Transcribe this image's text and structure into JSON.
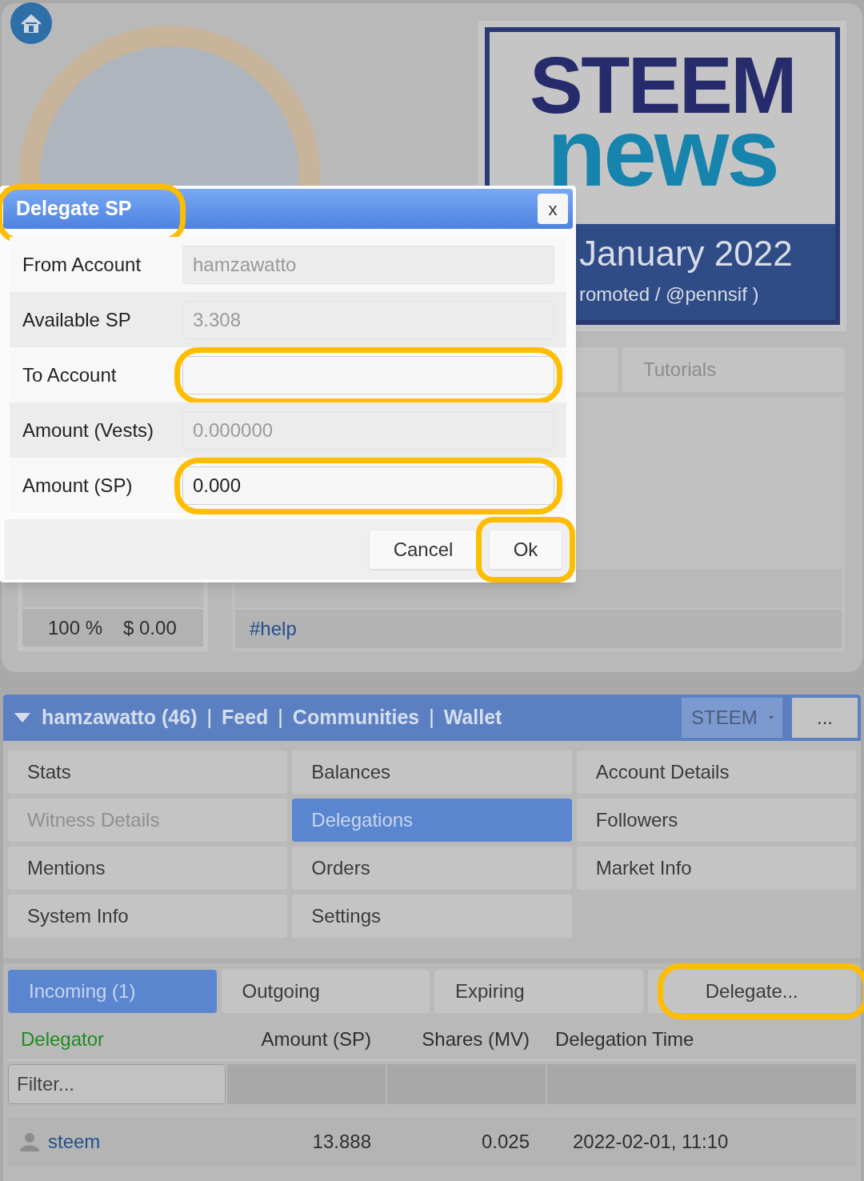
{
  "banner": {
    "logo_top": "STEEM",
    "logo_bottom": "news",
    "title": "January 2022",
    "subtitle": "romoted / @pennsif )"
  },
  "payout_table": {
    "rows": [
      {
        "percent": "100 %",
        "value": "$ 0.00"
      }
    ]
  },
  "tag_tabs": [
    {
      "label": "Tutorials",
      "selected": false
    }
  ],
  "tag_list": [
    {
      "label": "#help"
    }
  ],
  "dialog": {
    "title": "Delegate SP",
    "title_highlighted": true,
    "close": "x",
    "fields": [
      {
        "label": "From Account",
        "value": "hamzawatto",
        "disabled": true,
        "highlighted": false
      },
      {
        "label": "Available SP",
        "value": "3.308",
        "disabled": true,
        "highlighted": false
      },
      {
        "label": "To Account",
        "disabled": false,
        "highlighted": true
      },
      {
        "label": "Amount (Vests)",
        "value": "0.000000",
        "disabled": true,
        "highlighted": false
      },
      {
        "label": "Amount (SP)",
        "value": "0.000",
        "disabled": false,
        "highlighted": true
      }
    ],
    "buttons": [
      {
        "label": "Cancel",
        "highlighted": false
      },
      {
        "label": "Ok",
        "highlighted": true
      }
    ]
  },
  "navbar": {
    "items": [
      {
        "kind": "link",
        "label": "hamzawatto (46)"
      },
      {
        "kind": "separator",
        "label": "|"
      },
      {
        "kind": "link",
        "label": "Feed"
      },
      {
        "kind": "separator",
        "label": "|"
      },
      {
        "kind": "link",
        "label": "Communities"
      },
      {
        "kind": "separator",
        "label": "|"
      },
      {
        "kind": "link",
        "label": "Wallet"
      }
    ],
    "currency": "STEEM",
    "more": "..."
  },
  "menu": [
    {
      "label": "Stats",
      "selected": false,
      "disabled": false
    },
    {
      "label": "Balances",
      "selected": false,
      "disabled": false
    },
    {
      "label": "Account Details",
      "selected": false,
      "disabled": false
    },
    {
      "label": "Witness Details",
      "selected": false,
      "disabled": true
    },
    {
      "label": "Delegations",
      "selected": true,
      "disabled": false
    },
    {
      "label": "Followers",
      "selected": false,
      "disabled": false
    },
    {
      "label": "Mentions",
      "selected": false,
      "disabled": false
    },
    {
      "label": "Orders",
      "selected": false,
      "disabled": false
    },
    {
      "label": "Market Info",
      "selected": false,
      "disabled": false
    },
    {
      "label": "System Info",
      "selected": false,
      "disabled": false
    },
    {
      "label": "Settings",
      "selected": false,
      "disabled": false
    }
  ],
  "delegation_tabs": [
    {
      "label": "Incoming (1)",
      "selected": true,
      "highlighted": false
    },
    {
      "label": "Outgoing",
      "selected": false,
      "highlighted": false
    },
    {
      "label": "Expiring",
      "selected": false,
      "highlighted": false
    },
    {
      "label": "Delegate...",
      "selected": false,
      "highlighted": true
    }
  ],
  "table": {
    "columns": [
      {
        "label": "Delegator",
        "sorted": true
      },
      {
        "label": "Amount (SP)",
        "sorted": false
      },
      {
        "label": "Shares (MV)",
        "sorted": false
      },
      {
        "label": "Delegation Time",
        "sorted": false
      }
    ],
    "filter_placeholder": "Filter...",
    "rows": [
      [
        "steem",
        "13.888",
        "0.025",
        "2022-02-01, 11:10"
      ]
    ]
  }
}
